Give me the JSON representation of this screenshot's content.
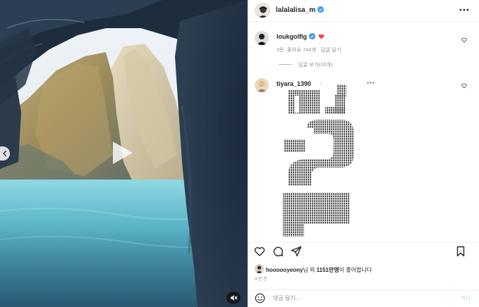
{
  "post": {
    "author": "lalalalisa_m",
    "verified": true
  },
  "comments": [
    {
      "username": "loukgolflg",
      "verified": true,
      "has_heart": true,
      "age": "3문",
      "likes": "좋아요 744개",
      "reply": "답글 달기",
      "view_replies": "답글 보기(10개)"
    },
    {
      "username": "tiyara_1390",
      "art_dots_1": "·",
      "art_dots_2": "+++"
    }
  ],
  "actions": [
    "heart-icon",
    "comment-icon",
    "share-icon",
    "bookmark-icon"
  ],
  "likes_bar": {
    "liker": "hoooooyeony",
    "mid": "님 외 ",
    "count": "1151만명",
    "tail": "이 좋아합니다"
  },
  "time_ago": "4 분 전",
  "comment_box": {
    "placeholder": "댓글 달기...",
    "post_label": "게시"
  },
  "colors": {
    "verified": "#3897f0",
    "heart": "#ed4956",
    "post_disabled": "#b2dffc"
  }
}
